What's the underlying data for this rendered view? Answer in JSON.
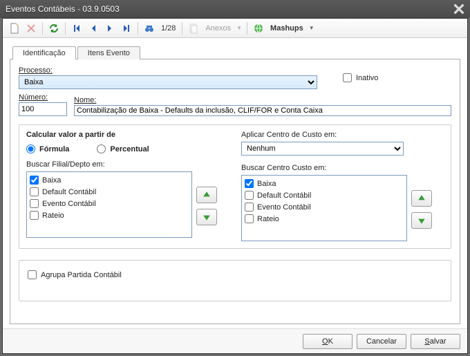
{
  "window": {
    "title": "Eventos Contábeis - 03.9.0503"
  },
  "toolbar": {
    "paging": "1/28",
    "anexos": "Anexos",
    "mashups": "Mashups"
  },
  "tabs": {
    "identificacao": "Identificação",
    "itens": "Itens Evento"
  },
  "fields": {
    "processo_label": "Processo:",
    "processo_value": "Baixa",
    "inativo_label": "Inativo",
    "numero_label": "Número:",
    "numero_value": "100",
    "nome_label": "Nome:",
    "nome_value": "Contabilização de Baixa - Defaults da inclusão, CLIF/FOR e Conta Caixa"
  },
  "calc": {
    "title": "Calcular valor a partir de",
    "formula": "Fórmula",
    "percentual": "Percentual"
  },
  "apply_cc": {
    "label": "Aplicar Centro de Custo em:",
    "value": "Nenhum"
  },
  "search_filial": {
    "label": "Buscar Filial/Depto em:",
    "items": [
      "Baixa",
      "Default Contábil",
      "Evento Contábil",
      "Rateio"
    ],
    "checked": [
      true,
      false,
      false,
      false
    ]
  },
  "search_cc": {
    "label": "Buscar Centro Custo em:",
    "items": [
      "Baixa",
      "Default Contábil",
      "Evento Contábil",
      "Rateio"
    ],
    "checked": [
      true,
      false,
      false,
      false
    ]
  },
  "agrupa": {
    "label": "Agrupa Partida Contábil"
  },
  "buttons": {
    "ok": "OK",
    "cancel": "Cancelar",
    "save": "Salvar"
  }
}
